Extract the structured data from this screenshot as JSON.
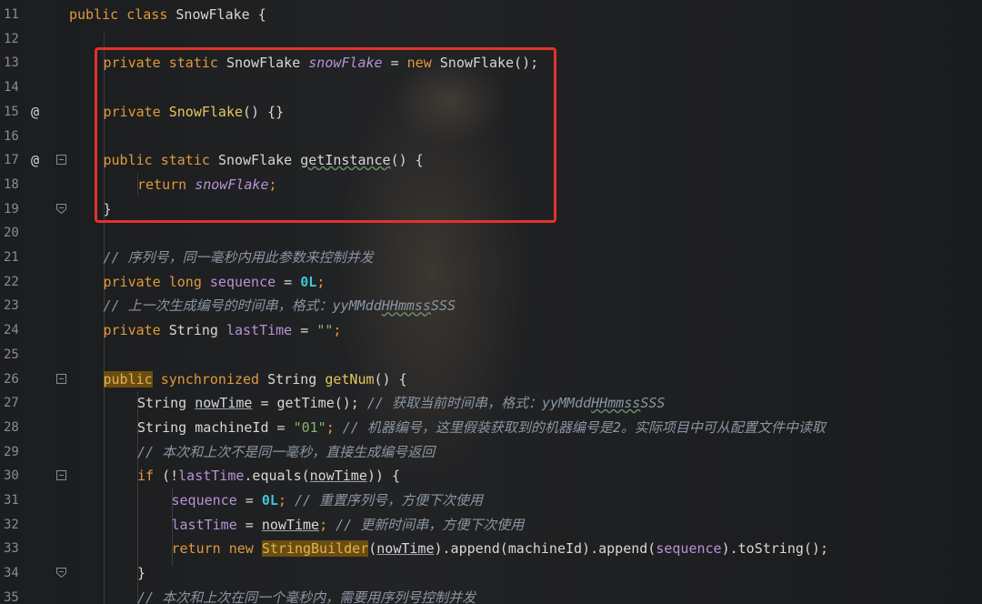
{
  "editor": {
    "lines": [
      {
        "num": "11",
        "mark": "",
        "fold": "",
        "indent": 0,
        "tokens": [
          {
            "t": "public class ",
            "c": "kw"
          },
          {
            "t": "SnowFlake {",
            "c": "id"
          }
        ]
      },
      {
        "num": "12",
        "mark": "",
        "fold": "",
        "indent": 0,
        "tokens": []
      },
      {
        "num": "13",
        "mark": "",
        "fold": "",
        "indent": 1,
        "tokens": [
          {
            "t": "private static ",
            "c": "kw"
          },
          {
            "t": "SnowFlake ",
            "c": "id"
          },
          {
            "t": "snowFlake",
            "c": "fldi"
          },
          {
            "t": " = ",
            "c": "id"
          },
          {
            "t": "new ",
            "c": "kw"
          },
          {
            "t": "SnowFlake();",
            "c": "id"
          }
        ]
      },
      {
        "num": "14",
        "mark": "",
        "fold": "",
        "indent": 0,
        "tokens": []
      },
      {
        "num": "15",
        "mark": "@",
        "fold": "",
        "indent": 1,
        "tokens": [
          {
            "t": "private ",
            "c": "kw"
          },
          {
            "t": "SnowFlake",
            "c": "method"
          },
          {
            "t": "() {}",
            "c": "id"
          }
        ]
      },
      {
        "num": "16",
        "mark": "",
        "fold": "",
        "indent": 0,
        "tokens": []
      },
      {
        "num": "17",
        "mark": "@",
        "fold": "open",
        "indent": 1,
        "tokens": [
          {
            "t": "public static ",
            "c": "kw"
          },
          {
            "t": "SnowFlake ",
            "c": "id"
          },
          {
            "t": "getInstance",
            "c": "id wavy"
          },
          {
            "t": "() {",
            "c": "id"
          }
        ]
      },
      {
        "num": "18",
        "mark": "",
        "fold": "",
        "indent": 2,
        "tokens": [
          {
            "t": "return ",
            "c": "kw"
          },
          {
            "t": "snowFlake",
            "c": "fldi"
          },
          {
            "t": ";",
            "c": "kw"
          }
        ]
      },
      {
        "num": "19",
        "mark": "",
        "fold": "close",
        "indent": 1,
        "tokens": [
          {
            "t": "}",
            "c": "id"
          }
        ]
      },
      {
        "num": "20",
        "mark": "",
        "fold": "",
        "indent": 0,
        "tokens": []
      },
      {
        "num": "21",
        "mark": "",
        "fold": "",
        "indent": 1,
        "tokens": [
          {
            "t": "// 序列号，同一毫秒内用此参数来控制并发",
            "c": "cmt"
          }
        ]
      },
      {
        "num": "22",
        "mark": "",
        "fold": "",
        "indent": 1,
        "tokens": [
          {
            "t": "private long ",
            "c": "kw"
          },
          {
            "t": "sequence",
            "c": "fld"
          },
          {
            "t": " = ",
            "c": "id"
          },
          {
            "t": "0L",
            "c": "num"
          },
          {
            "t": ";",
            "c": "kw"
          }
        ]
      },
      {
        "num": "23",
        "mark": "",
        "fold": "",
        "indent": 1,
        "tokens": [
          {
            "t": "// 上一次生成编号的时间串，格式：yyMMdd",
            "c": "cmt"
          },
          {
            "t": "HHmmss",
            "c": "cmt wavy"
          },
          {
            "t": "SSS",
            "c": "cmt"
          }
        ]
      },
      {
        "num": "24",
        "mark": "",
        "fold": "",
        "indent": 1,
        "tokens": [
          {
            "t": "private ",
            "c": "kw"
          },
          {
            "t": "String ",
            "c": "id"
          },
          {
            "t": "lastTime",
            "c": "fld"
          },
          {
            "t": " = ",
            "c": "id"
          },
          {
            "t": "\"\"",
            "c": "str"
          },
          {
            "t": ";",
            "c": "kw"
          }
        ]
      },
      {
        "num": "25",
        "mark": "",
        "fold": "",
        "indent": 0,
        "tokens": []
      },
      {
        "num": "26",
        "mark": "",
        "fold": "open",
        "indent": 1,
        "tokens": [
          {
            "t": "public",
            "c": "hl"
          },
          {
            "t": " synchronized ",
            "c": "kw"
          },
          {
            "t": "String ",
            "c": "id"
          },
          {
            "t": "getNum",
            "c": "method"
          },
          {
            "t": "() {",
            "c": "id"
          }
        ]
      },
      {
        "num": "27",
        "mark": "",
        "fold": "",
        "indent": 2,
        "tokens": [
          {
            "t": "String ",
            "c": "id"
          },
          {
            "t": "nowTime",
            "c": "id uline"
          },
          {
            "t": " = getTime(); ",
            "c": "id"
          },
          {
            "t": "// 获取当前时间串，格式：yyMMdd",
            "c": "cmt"
          },
          {
            "t": "HHmmss",
            "c": "cmt wavy"
          },
          {
            "t": "SSS",
            "c": "cmt"
          }
        ]
      },
      {
        "num": "28",
        "mark": "",
        "fold": "",
        "indent": 2,
        "tokens": [
          {
            "t": "String machineId = ",
            "c": "id"
          },
          {
            "t": "\"01\"",
            "c": "str"
          },
          {
            "t": "; ",
            "c": "kw"
          },
          {
            "t": "// 机器编号，这里假装获取到的机器编号是2。实际项目中可从配置文件中读取",
            "c": "cmt"
          }
        ]
      },
      {
        "num": "29",
        "mark": "",
        "fold": "",
        "indent": 2,
        "tokens": [
          {
            "t": "// 本次和上次不是同一毫秒，直接生成编号返回",
            "c": "cmt"
          }
        ]
      },
      {
        "num": "30",
        "mark": "",
        "fold": "open",
        "indent": 2,
        "tokens": [
          {
            "t": "if ",
            "c": "kw"
          },
          {
            "t": "(!",
            "c": "id"
          },
          {
            "t": "lastTime",
            "c": "fld"
          },
          {
            "t": ".equals(",
            "c": "id"
          },
          {
            "t": "nowTime",
            "c": "id uline"
          },
          {
            "t": ")) {",
            "c": "id"
          }
        ]
      },
      {
        "num": "31",
        "mark": "",
        "fold": "",
        "indent": 3,
        "tokens": [
          {
            "t": "sequence",
            "c": "fld"
          },
          {
            "t": " = ",
            "c": "id"
          },
          {
            "t": "0L",
            "c": "num"
          },
          {
            "t": "; ",
            "c": "kw"
          },
          {
            "t": "// 重置序列号，方便下次使用",
            "c": "cmt"
          }
        ]
      },
      {
        "num": "32",
        "mark": "",
        "fold": "",
        "indent": 3,
        "tokens": [
          {
            "t": "lastTime",
            "c": "fld"
          },
          {
            "t": " = ",
            "c": "id"
          },
          {
            "t": "nowTime",
            "c": "id uline"
          },
          {
            "t": "; ",
            "c": "kw"
          },
          {
            "t": "// 更新时间串，方便下次使用",
            "c": "cmt"
          }
        ]
      },
      {
        "num": "33",
        "mark": "",
        "fold": "",
        "indent": 3,
        "tokens": [
          {
            "t": "return new ",
            "c": "kw"
          },
          {
            "t": "StringBuilder",
            "c": "hl"
          },
          {
            "t": "(",
            "c": "id"
          },
          {
            "t": "nowTime",
            "c": "id uline"
          },
          {
            "t": ").append(machineId).append(",
            "c": "id"
          },
          {
            "t": "sequence",
            "c": "fld"
          },
          {
            "t": ").toString();",
            "c": "id"
          }
        ]
      },
      {
        "num": "34",
        "mark": "",
        "fold": "close",
        "indent": 2,
        "tokens": [
          {
            "t": "}",
            "c": "id"
          }
        ]
      },
      {
        "num": "35",
        "mark": "",
        "fold": "",
        "indent": 2,
        "tokens": [
          {
            "t": "// 本次和上次在同一个毫秒内，需要用序列号控制并发",
            "c": "cmt"
          }
        ]
      }
    ]
  },
  "colors": {
    "keyword": "#e09a3c",
    "field": "#b693d6",
    "method": "#e6c85c",
    "number": "#3fc7d8",
    "string": "#88b56a",
    "comment": "#8a96a3",
    "highlight_bg": "#6a4d12",
    "box": "#e0332c"
  },
  "icons": {
    "override": "at-sign-icon",
    "fold_open": "fold-minus-icon",
    "fold_close": "fold-end-icon"
  }
}
